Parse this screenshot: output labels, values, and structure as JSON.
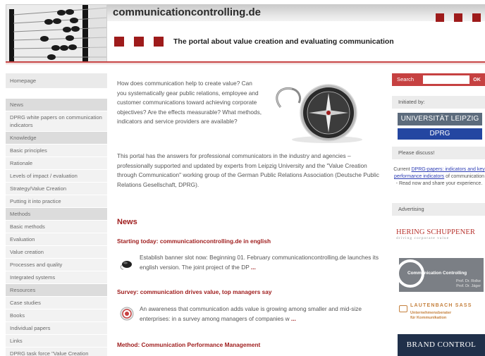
{
  "header": {
    "site_name": "communicationcontrolling.de",
    "tagline": "The portal about value creation and evaluating communication"
  },
  "colors": {
    "accent": "#9e1b1b",
    "header_rule": "#c64141",
    "nav_background": "#ededed",
    "dprg_blue": "#2446a1"
  },
  "left_nav": {
    "items": [
      "Homepage",
      "News",
      "DPRG white papers on communication indicators",
      "Knowledge",
      "Basic principles",
      "Rationale",
      "Levels of impact / evaluation",
      "Strategy/Value Creation",
      "Putting it into practice",
      "Methods",
      "Basic methods",
      "Evaluation",
      "Value creation",
      "Processes and quality",
      "Integrated systems",
      "Resources",
      "Case studies",
      "Books",
      "Individual papers",
      "Links",
      "DPRG task force \"Value Creation through Communication\""
    ]
  },
  "main": {
    "intro": "How does communication help to create value? Can you systematically gear public relations, employee and customer communications toward achieving corporate objectives? Are the effects measurable? What methods, indicators and service providers are available?",
    "portal": "This portal has the answers for professional communicators in the industry and agencies – professionally supported and updated by experts from Leipzig University and the \"Value Creation through Communication\" working group of the German Public Relations Association (Deutsche Public Relations Gesellschaft, DPRG).",
    "news_heading": "News",
    "news": [
      {
        "title": "Starting today: communicationcontrolling.de in english",
        "body": "Establish banner slot now: Beginning 01. February communicationcontrolling.de launches its english version. The joint project of the DP",
        "more": "..."
      },
      {
        "title": "Survey: communication drives value, top managers say",
        "body": "An awareness that communication adds value is growing among smaller and mid-size enterprises: in a survey among managers of companies w",
        "more": "..."
      },
      {
        "title": "Method: Communication Performance Management"
      }
    ]
  },
  "sidebar": {
    "search_label": "Search",
    "search_placeholder": "",
    "search_button": "OK",
    "initiated_by": "Initiated by:",
    "leipzig": "UNIVERSITÄT LEIPZIG",
    "dprg": "DPRG",
    "please_discuss": "Please discuss!",
    "discuss_prefix": "Current ",
    "discuss_link": "DPRG-papers: indicators and key performance indicators",
    "discuss_suffix": " of communication - Read now and share your experience.",
    "advertising": "Advertising",
    "ads": {
      "hering": "HERING SCHUPPENER",
      "hering_sub": "driving corporate value",
      "cc": "Communication Controlling",
      "cc_prof1": "Prof. Dr. Rolke",
      "cc_prof2": "Prof. Dr. Jäger",
      "lautenbach": "LAUTENBACH SASS",
      "lautenbach_sub1": "Unternehmensberater",
      "lautenbach_sub2": "für Kommunikation",
      "brand": "BRAND CONTROL"
    }
  }
}
